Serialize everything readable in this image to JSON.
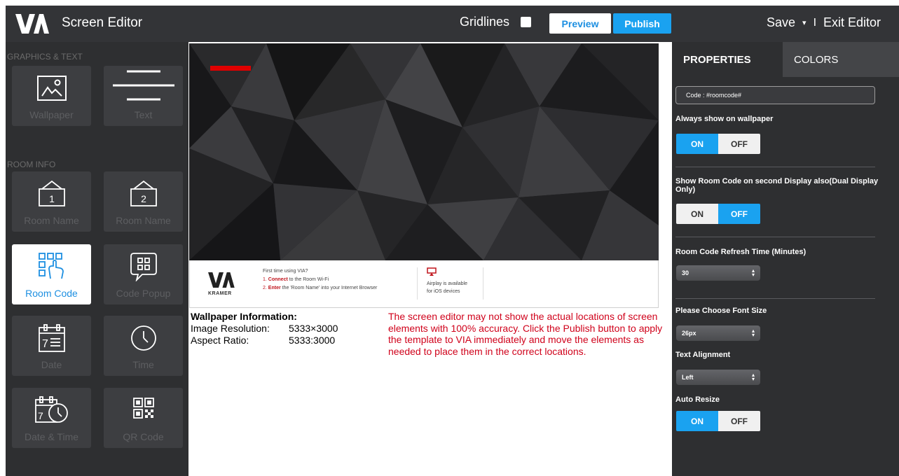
{
  "header": {
    "logo_text": "VIA",
    "title": "Screen Editor",
    "gridlines_label": "Gridlines",
    "preview_label": "Preview",
    "publish_label": "Publish",
    "save_label": "Save",
    "save_arrow": "▾",
    "separator": "I",
    "exit_label": "Exit Editor"
  },
  "sidebar": {
    "graphics_label": "GRAPHICS & TEXT",
    "room_info_label": "ROOM INFO",
    "tiles": [
      {
        "label": "Wallpaper",
        "icon": "image-icon"
      },
      {
        "label": "Text",
        "icon": "text-lines-icon"
      },
      {
        "label": "Room Name",
        "icon": "room-sign-1-icon"
      },
      {
        "label": "Room Name",
        "icon": "room-sign-2-icon"
      },
      {
        "label": "Room Code",
        "icon": "touch-grid-icon"
      },
      {
        "label": "Code Popup",
        "icon": "code-popup-icon"
      },
      {
        "label": "Date",
        "icon": "calendar-icon"
      },
      {
        "label": "Time",
        "icon": "clock-icon"
      },
      {
        "label": "Date & Time",
        "icon": "calendar-clock-icon"
      },
      {
        "label": "QR Code",
        "icon": "qr-code-icon"
      }
    ]
  },
  "canvas": {
    "banner": {
      "kramer": "KRAMER",
      "line1": "First time using VIA?",
      "line2_num": "1.",
      "line2_bold": "Connect",
      "line2_rest": " to the Room Wi-Fi",
      "line3_num": "2.",
      "line3_bold": "Enter",
      "line3_rest": " the 'Room Name' into your Internet Browser",
      "airplay_line1": "Airplay is available",
      "airplay_line2": "for iOS devices"
    },
    "info": {
      "heading": "Wallpaper Information:",
      "resolution_label": "Image Resolution:",
      "resolution_value": "5333×3000",
      "aspect_label": "Aspect Ratio:",
      "aspect_value": "5333:3000"
    },
    "warning": "The screen editor may not show the actual locations of screen elements with 100% accuracy. Click the Publish button to apply the template to VIA immediately and move the elements as needed to place them in the correct locations."
  },
  "panel": {
    "tab_properties": "PROPERTIES",
    "tab_colors": "COLORS",
    "code_field": "Code : #roomcode#",
    "always_show_label": "Always show on wallpaper",
    "always_show": {
      "on": "ON",
      "off": "OFF",
      "value": "ON"
    },
    "second_display_label": "Show Room Code on second Display also(Dual Display Only)",
    "second_display": {
      "on": "ON",
      "off": "OFF",
      "value": "OFF"
    },
    "refresh_label": "Room Code Refresh Time (Minutes)",
    "refresh_value": "30",
    "font_size_label": "Please Choose Font Size",
    "font_size_value": "26px",
    "alignment_label": "Text Alignment",
    "alignment_value": "Left",
    "auto_resize_label": "Auto Resize",
    "auto_resize": {
      "on": "ON",
      "off": "OFF",
      "value": "ON"
    }
  },
  "colors": {
    "accent": "#1aa2f0",
    "warning": "#d0021b",
    "dark_bg": "#2e2f31"
  }
}
